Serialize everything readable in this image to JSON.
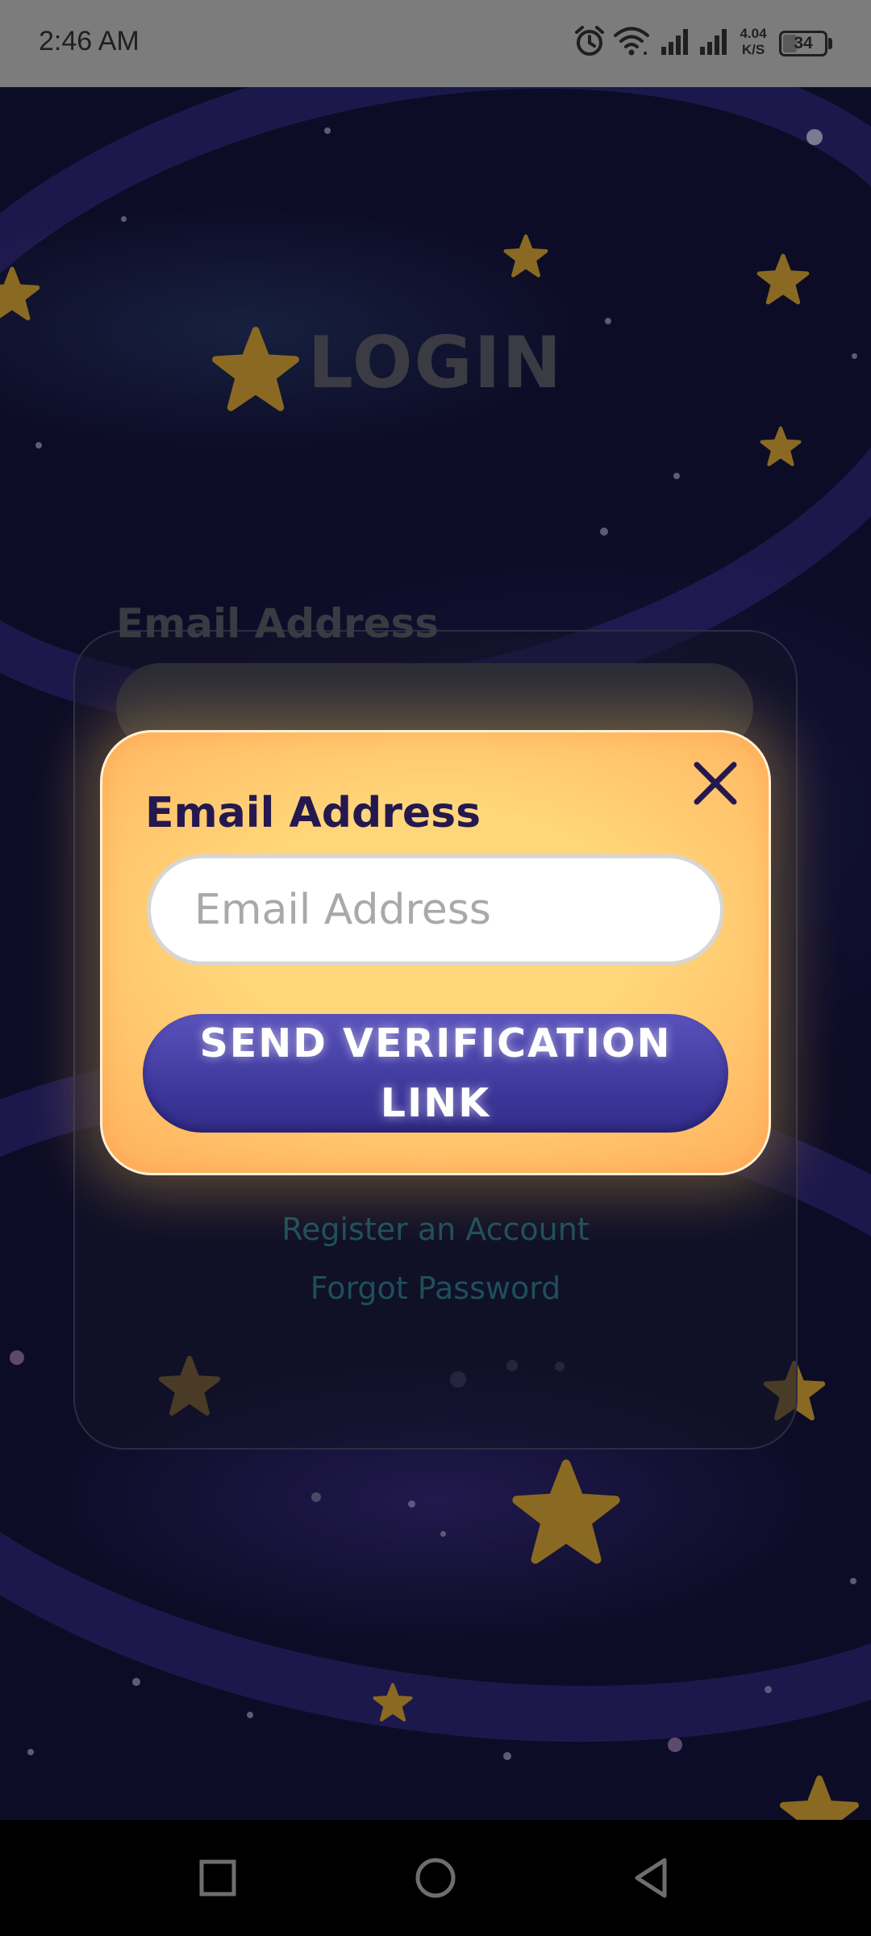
{
  "status_bar": {
    "time": "2:46 AM",
    "net_speed_value": "4.04",
    "net_speed_unit": "K/S",
    "battery_level": "34",
    "icons": [
      "alarm-icon",
      "wifi-icon",
      "signal-icon",
      "signal-icon"
    ]
  },
  "background_screen": {
    "title": "LOGIN",
    "email_label": "Email Address",
    "register_link": "Register an Account",
    "forgot_link": "Forgot Password"
  },
  "modal": {
    "label": "Email Address",
    "email_placeholder": "Email Address",
    "email_value": "",
    "send_button_label": "SEND VERIFICATION LINK",
    "close_icon": "close-icon"
  },
  "nav_bar": {
    "buttons": [
      "recent-apps-icon",
      "home-icon",
      "back-icon"
    ]
  },
  "colors": {
    "modal_accent": "#ffc86a",
    "button": "#3d379b",
    "label_text": "#24184f",
    "background": "#0d0c26"
  }
}
